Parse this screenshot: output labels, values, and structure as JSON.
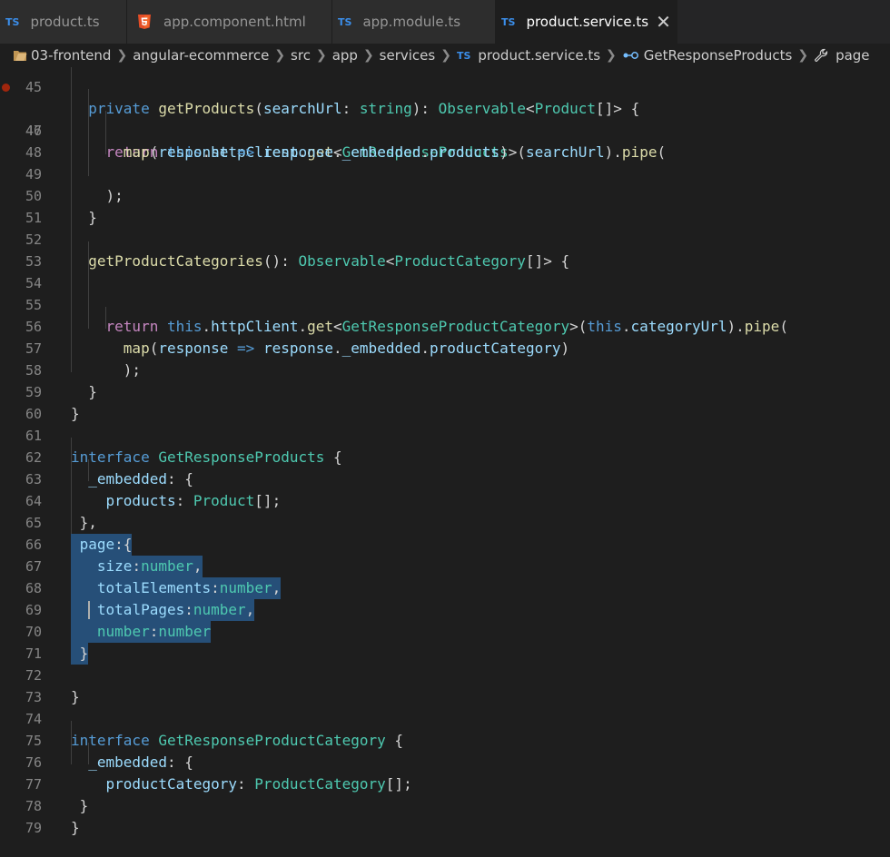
{
  "tabs": [
    {
      "icon": "TS",
      "label": "product.ts"
    },
    {
      "icon": "html",
      "label": "app.component.html"
    },
    {
      "icon": "TS",
      "label": "app.module.ts"
    },
    {
      "icon": "TS",
      "label": "product.service.ts",
      "active": true
    }
  ],
  "breadcrumb": {
    "items": [
      "03-frontend",
      "angular-ecommerce",
      "src",
      "app",
      "services",
      "product.service.ts",
      "GetResponseProducts",
      "page"
    ],
    "ts_badge": "TS"
  },
  "close_symbol": "✕",
  "code_lines": [
    {
      "n": "45",
      "text": "  private getProducts(searchUrl: string): Observable<Product[]> {"
    },
    {
      "n": "46",
      "text": "    return this.httpClient.get<GetResponseProducts>(searchUrl).pipe("
    },
    {
      "n": "47",
      "text": "      map(response => response._embedded.products)"
    },
    {
      "n": "48",
      "text": ""
    },
    {
      "n": "49",
      "text": "    );"
    },
    {
      "n": "50",
      "text": "  }"
    },
    {
      "n": "51",
      "text": ""
    },
    {
      "n": "52",
      "text": "  getProductCategories(): Observable<ProductCategory[]> {"
    },
    {
      "n": "53",
      "text": ""
    },
    {
      "n": "54",
      "text": ""
    },
    {
      "n": "55",
      "text": "    return this.httpClient.get<GetResponseProductCategory>(this.categoryUrl).pipe("
    },
    {
      "n": "56",
      "text": "      map(response => response._embedded.productCategory)"
    },
    {
      "n": "57",
      "text": "      );"
    },
    {
      "n": "58",
      "text": "  }"
    },
    {
      "n": "59",
      "text": "}"
    },
    {
      "n": "60",
      "text": ""
    },
    {
      "n": "61",
      "text": "interface GetResponseProducts {"
    },
    {
      "n": "62",
      "text": "  _embedded: {"
    },
    {
      "n": "63",
      "text": "    products: Product[];"
    },
    {
      "n": "64",
      "text": " },"
    },
    {
      "n": "65",
      "text": " page:{"
    },
    {
      "n": "66",
      "text": "   size:number,"
    },
    {
      "n": "67",
      "text": "   totalElements:number,"
    },
    {
      "n": "68",
      "text": "   totalPages:number,"
    },
    {
      "n": "69",
      "text": "   number:number"
    },
    {
      "n": "70",
      "text": " }"
    },
    {
      "n": "71",
      "text": ""
    },
    {
      "n": "72",
      "text": "}"
    },
    {
      "n": "73",
      "text": ""
    },
    {
      "n": "74",
      "text": "interface GetResponseProductCategory {"
    },
    {
      "n": "75",
      "text": "  _embedded: {"
    },
    {
      "n": "76",
      "text": "    productCategory: ProductCategory[];"
    },
    {
      "n": "77",
      "text": " }"
    },
    {
      "n": "78",
      "text": "}"
    },
    {
      "n": "79",
      "text": ""
    }
  ],
  "colors": {
    "background": "#1e1e1e",
    "selection": "#264f78",
    "keyword": "#569cd6",
    "control": "#c586c0",
    "function": "#dcdcaa",
    "type": "#4ec9b0",
    "variable": "#9cdcfe",
    "string": "#ce9178",
    "ts_icon": "#3b8eea",
    "html_icon": "#e44d26",
    "breakpoint": "#a1260d"
  }
}
